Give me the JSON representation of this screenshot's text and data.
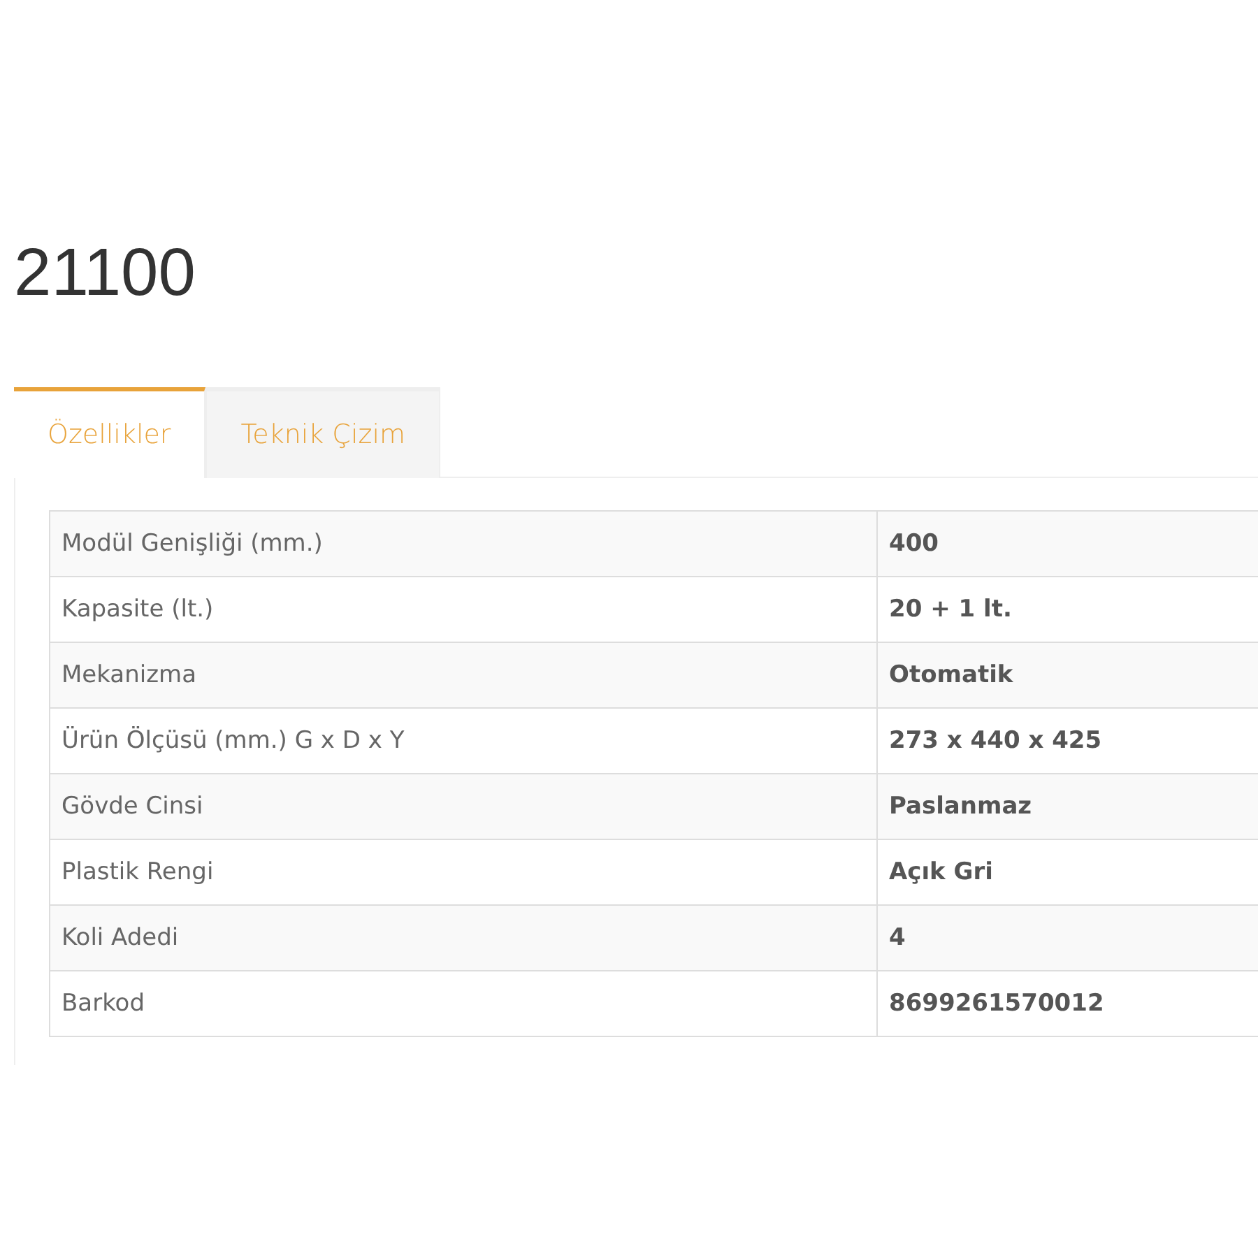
{
  "title": "21100",
  "tabs": [
    {
      "label": "Özellikler",
      "selected": true
    },
    {
      "label": "Teknik Çizim",
      "selected": false
    }
  ],
  "specs": [
    {
      "label": "Modül Genişliği (mm.)",
      "value": "400"
    },
    {
      "label": "Kapasite (lt.)",
      "value": "20 + 1 lt."
    },
    {
      "label": "Mekanizma",
      "value": "Otomatik"
    },
    {
      "label": "Ürün Ölçüsü (mm.) G x D x Y",
      "value": "273 x 440 x 425"
    },
    {
      "label": "Gövde Cinsi",
      "value": "Paslanmaz"
    },
    {
      "label": "Plastik Rengi",
      "value": "Açık Gri"
    },
    {
      "label": "Koli Adedi",
      "value": "4"
    },
    {
      "label": "Barkod",
      "value": "8699261570012"
    }
  ]
}
